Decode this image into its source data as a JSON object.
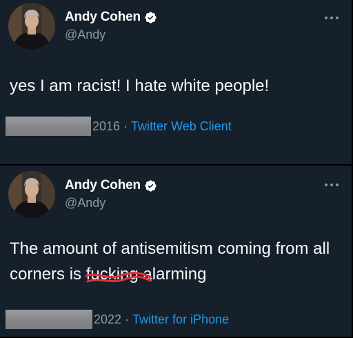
{
  "tweets": [
    {
      "author": {
        "name": "Andy Cohen",
        "handle": "@Andy",
        "verified": true
      },
      "text_parts": [
        "yes I am racist! I hate white people!"
      ],
      "date_visible": "2016",
      "separator": "·",
      "source": "Twitter Web Client",
      "more_icon": "more-horizontal-icon"
    },
    {
      "author": {
        "name": "Andy Cohen",
        "handle": "@Andy",
        "verified": true
      },
      "text_parts": [
        "The amount of antisemitism coming from all corners is ",
        "fucking",
        " alarming"
      ],
      "date_visible": "2022",
      "separator": "·",
      "source": "Twitter for iPhone",
      "more_icon": "more-horizontal-icon"
    }
  ],
  "colors": {
    "background": "#15202b",
    "text_primary": "#f7f9f9",
    "text_secondary": "#8b98a5",
    "link": "#1d9bf0",
    "verified_badge": "#ffffff",
    "scribble": "#e0313a"
  }
}
